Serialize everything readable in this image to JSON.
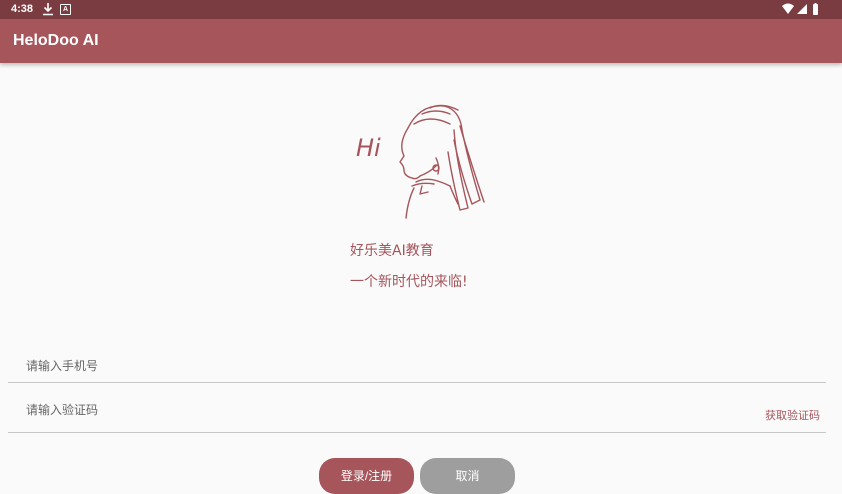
{
  "status_bar": {
    "time": "4:38",
    "icons": [
      "download-icon",
      "app-a-icon",
      "wifi-icon",
      "signal-icon",
      "battery-icon"
    ],
    "a_glyph": "A"
  },
  "app_bar": {
    "title": "HeloDoo AI"
  },
  "hero": {
    "greeting": "Hi"
  },
  "tagline": {
    "line1": "好乐美AI教育",
    "line2": "一个新时代的来临!"
  },
  "form": {
    "phone_placeholder": "请输入手机号",
    "phone_value": "",
    "code_placeholder": "请输入验证码",
    "code_value": "",
    "get_code_label": "获取验证码"
  },
  "buttons": {
    "login_label": "登录/注册",
    "cancel_label": "取消"
  },
  "colors": {
    "status_bar": "#7b3c41",
    "primary": "#a6555b",
    "cancel": "#9e9e9e",
    "background": "#fafafa"
  }
}
